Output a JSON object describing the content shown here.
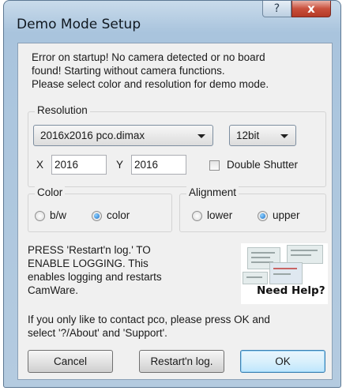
{
  "window": {
    "title": "Demo Mode Setup",
    "help_label": "?",
    "close_label": "x"
  },
  "message": {
    "line1": "Error on startup! No camera detected or no board",
    "line2": "found! Starting without camera functions.",
    "line3": "Please select color and resolution for demo mode."
  },
  "resolution": {
    "group_label": "Resolution",
    "format_value": "2016x2016 pco.dimax",
    "bitdepth_value": "12bit",
    "x_label": "X",
    "x_value": "2016",
    "y_label": "Y",
    "y_value": "2016",
    "double_shutter_label": "Double Shutter",
    "double_shutter_checked": false
  },
  "color": {
    "group_label": "Color",
    "options": [
      {
        "label": "b/w",
        "selected": false
      },
      {
        "label": "color",
        "selected": true
      }
    ]
  },
  "alignment": {
    "group_label": "Alignment",
    "options": [
      {
        "label": "lower",
        "selected": false
      },
      {
        "label": "upper",
        "selected": true
      }
    ]
  },
  "logging": {
    "line1": "PRESS 'Restart'n log.' TO",
    "line2": "ENABLE LOGGING. This",
    "line3": "enables logging and restarts",
    "line4": "CamWare."
  },
  "help_image": {
    "caption": "Need Help?"
  },
  "contact": {
    "line1": "If you only like to contact pco, please press OK and",
    "line2": "select '?/About' and 'Support'."
  },
  "buttons": {
    "cancel": "Cancel",
    "restart": "Restart'n log.",
    "ok": "OK"
  },
  "colors": {
    "accent": "#1a6ec8",
    "close_button": "#c9503c"
  }
}
